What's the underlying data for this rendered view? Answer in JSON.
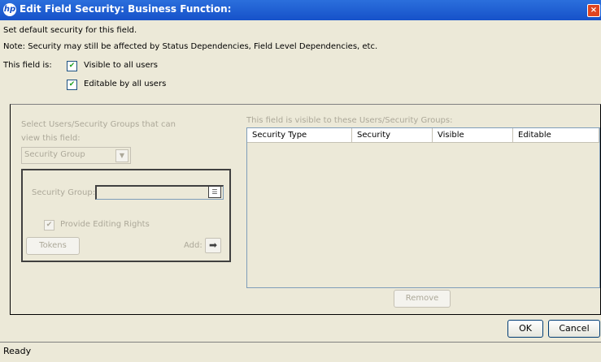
{
  "window": {
    "title": "Edit Field Security: Business Function:",
    "icon": "hp-logo-icon",
    "close_label": "×"
  },
  "info": {
    "line1": "Set default security for this field.",
    "line2": "Note: Security may still be affected by Status Dependencies, Field Level Dependencies, etc."
  },
  "field_is": {
    "label": "This field is:",
    "visible_label": "Visible to all users",
    "visible_checked": true,
    "editable_label": "Editable by all users",
    "editable_checked": true
  },
  "left": {
    "select_label_1": "Select Users/Security Groups that can",
    "select_label_2": "view this field:",
    "type_value": "Security Group",
    "security_group_label": "Security Group:",
    "provide_editing_label": "Provide Editing Rights",
    "tokens_button": "Tokens",
    "add_label": "Add:"
  },
  "right": {
    "label": "This field is visible to these Users/Security Groups:",
    "columns": [
      "Security Type",
      "Security",
      "Visible",
      "Editable"
    ],
    "remove_button": "Remove"
  },
  "footer": {
    "ok": "OK",
    "cancel": "Cancel"
  },
  "status": {
    "text": "Ready"
  }
}
